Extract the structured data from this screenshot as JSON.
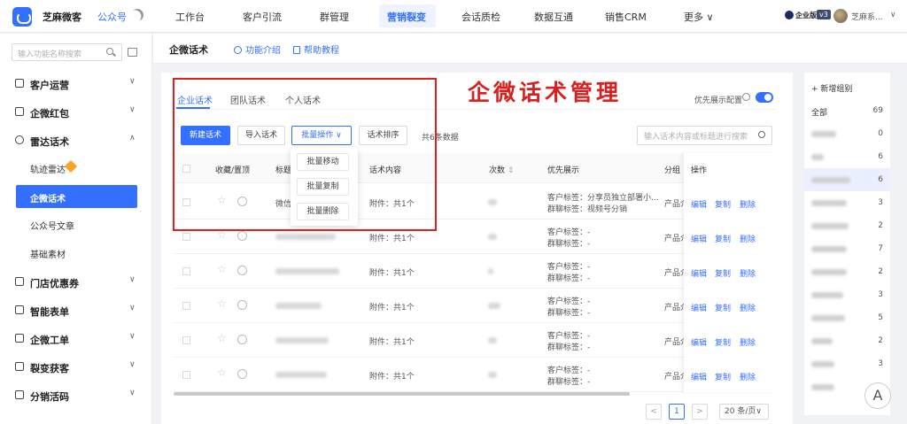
{
  "topbar": {
    "brand": "芝麻微客",
    "mp_label": "公众号",
    "nav": [
      "工作台",
      "客户引流",
      "群管理",
      "营销裂变",
      "会话质检",
      "数据互通",
      "销售CRM",
      "更多 ∨"
    ],
    "active_nav": "营销裂变",
    "enterprise_badge": "企业版",
    "version": "v3",
    "user": "芝麻系...",
    "user_chevron": "∨"
  },
  "sidebar": {
    "search_placeholder": "输入功能名称搜索",
    "groups": [
      {
        "label": "客户运营",
        "chev": "∨"
      },
      {
        "label": "企微红包",
        "chev": "∨"
      },
      {
        "label": "雷达话术",
        "chev": "∧"
      },
      {
        "label": "门店优惠券",
        "chev": "∨"
      },
      {
        "label": "智能表单",
        "chev": "∨"
      },
      {
        "label": "企微工单",
        "chev": "∨"
      },
      {
        "label": "裂变获客",
        "chev": "∨"
      },
      {
        "label": "分销活码",
        "chev": "∨"
      }
    ],
    "sub_items": [
      "轨迹雷达",
      "企微话术",
      "公众号文章",
      "基础素材"
    ],
    "active_sub": "企微话术"
  },
  "page": {
    "title": "企微话术",
    "intro_link": "功能介绍",
    "tutorial_link": "帮助教程"
  },
  "tabs": [
    "企业话术",
    "团队话术",
    "个人话术"
  ],
  "priority_label": "优先展示配置",
  "toolbar": {
    "new": "新建话术",
    "import": "导入话术",
    "batch": "批量操作",
    "batch_chevron": "∨",
    "sort": "话术排序",
    "total": "共6条数据",
    "search_placeholder": "输入话术内容或标题进行搜索"
  },
  "batch_menu": [
    "批量移动",
    "批量复制",
    "批量删除"
  ],
  "table": {
    "headers": [
      "收藏/置顶",
      "标题",
      "话术内容",
      "次数",
      "优先展示",
      "分组",
      "操作"
    ],
    "rows": [
      {
        "title": "微信",
        "content": "附件：共1个",
        "priority": [
          "客户标签：分享员独立部署小...",
          "群聊标签：视频号分销"
        ],
        "group": "产品介"
      },
      {
        "title": "",
        "content": "附件：共1个",
        "priority": [
          "客户标签：-",
          "群聊标签：-"
        ],
        "group": "产品介"
      },
      {
        "title": "",
        "content": "附件：共1个",
        "priority": [
          "客户标签：-",
          "群聊标签：-"
        ],
        "group": "产品介"
      },
      {
        "title": "",
        "content": "附件：共1个",
        "priority": [
          "客户标签：-",
          "群聊标签：-"
        ],
        "group": "产品介"
      },
      {
        "title": "",
        "content": "附件：共1个",
        "priority": [
          "客户标签：-",
          "群聊标签：-"
        ],
        "group": "产品介"
      },
      {
        "title": "",
        "content": "附件：共1个",
        "priority": [
          "客户标签：-",
          "群聊标签：-"
        ],
        "group": "产品介"
      }
    ],
    "ops": [
      "编辑",
      "复制",
      "删除"
    ]
  },
  "annotation": {
    "title": "企微话术管理",
    "color": "#e02020"
  },
  "pagination": {
    "prev": "<",
    "current": "1",
    "next": ">",
    "page_size": "20 条/页",
    "page_size_chevron": "∨"
  },
  "right_panel": {
    "add_group": "+ 新增组别",
    "groups": [
      {
        "name": "全部",
        "count": "69"
      },
      {
        "name": "",
        "count": "0"
      },
      {
        "name": "",
        "count": "6"
      },
      {
        "name": "",
        "count": "6"
      },
      {
        "name": "",
        "count": "3"
      },
      {
        "name": "",
        "count": "2"
      },
      {
        "name": "",
        "count": "7"
      },
      {
        "name": "",
        "count": "2"
      },
      {
        "name": "",
        "count": "3"
      },
      {
        "name": "",
        "count": "5"
      },
      {
        "name": "",
        "count": "2"
      },
      {
        "name": "",
        "count": "3"
      },
      {
        "name": "",
        "count": ""
      }
    ],
    "active_index": 3
  },
  "float_button": "A",
  "colors": {
    "accent": "#3370ff",
    "annotation": "#e02020"
  }
}
